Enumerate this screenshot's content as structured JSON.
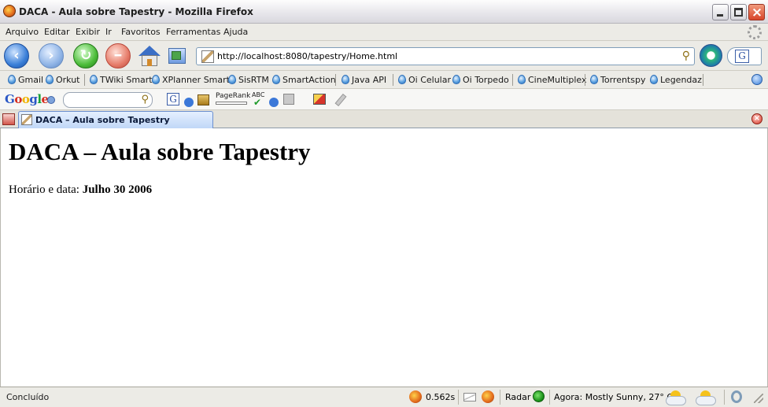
{
  "window": {
    "title": "DACA - Aula sobre Tapestry - Mozilla Firefox"
  },
  "menu": {
    "items": [
      "Arquivo",
      "Editar",
      "Exibir",
      "Ir",
      "Favoritos",
      "Ferramentas",
      "Ajuda"
    ]
  },
  "navigation": {
    "back_icon": "back-arrow-icon",
    "forward_icon": "forward-arrow-icon",
    "reload_icon": "reload-icon",
    "stop_icon": "stop-icon",
    "home_icon": "home-icon",
    "url": "http://localhost:8080/tapestry/Home.html",
    "search_glyph": "G"
  },
  "bookmarks": {
    "items": [
      "Gmail",
      "Orkut",
      "TWiki Smart",
      "XPlanner Smart",
      "SisRTM",
      "SmartAction",
      "Java API",
      "Oi Celular",
      "Oi Torpedo",
      "CineMultiplex",
      "Torrentspy",
      "Legendaz"
    ]
  },
  "google_toolbar": {
    "logo": [
      "G",
      "o",
      "o",
      "g",
      "l",
      "e"
    ],
    "search_value": "",
    "g_glyph": "G",
    "pagerank_label": "PageRank",
    "spell_label": "ABC"
  },
  "tab": {
    "label": "DACA – Aula sobre Tapestry"
  },
  "page": {
    "heading": "DACA – Aula sobre Tapestry",
    "date_label": "Horário e data:",
    "date_value": "Julho 30 2006"
  },
  "status": {
    "text": "Concluído",
    "load_time": "0.562s",
    "radar_label": "Radar",
    "weather": "Agora: Mostly Sunny, 27° C"
  }
}
